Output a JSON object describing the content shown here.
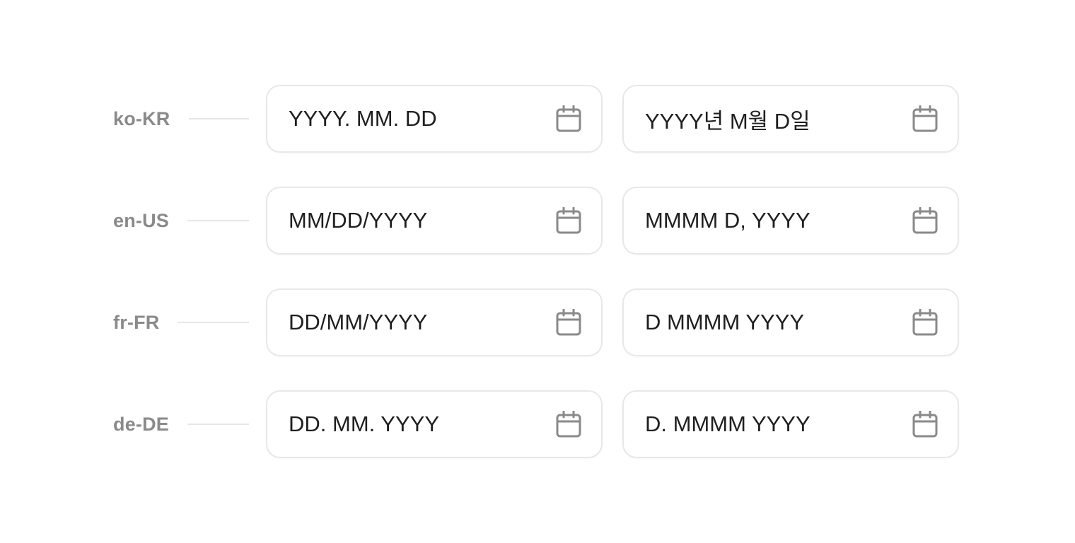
{
  "rows": [
    {
      "locale": "ko-KR",
      "short_placeholder": "YYYY. MM. DD",
      "long_placeholder": "YYYY년 M월 D일"
    },
    {
      "locale": "en-US",
      "short_placeholder": "MM/DD/YYYY",
      "long_placeholder": "MMMM D, YYYY"
    },
    {
      "locale": "fr-FR",
      "short_placeholder": "DD/MM/YYYY",
      "long_placeholder": "D MMMM YYYY"
    },
    {
      "locale": "de-DE",
      "short_placeholder": "DD. MM. YYYY",
      "long_placeholder": "D. MMMM YYYY"
    }
  ],
  "icons": {
    "calendar": "calendar-icon"
  },
  "colors": {
    "label": "#8a8a8a",
    "text": "#1f1f1f",
    "border": "#e8e8e8",
    "icon": "#8a8a8a"
  }
}
